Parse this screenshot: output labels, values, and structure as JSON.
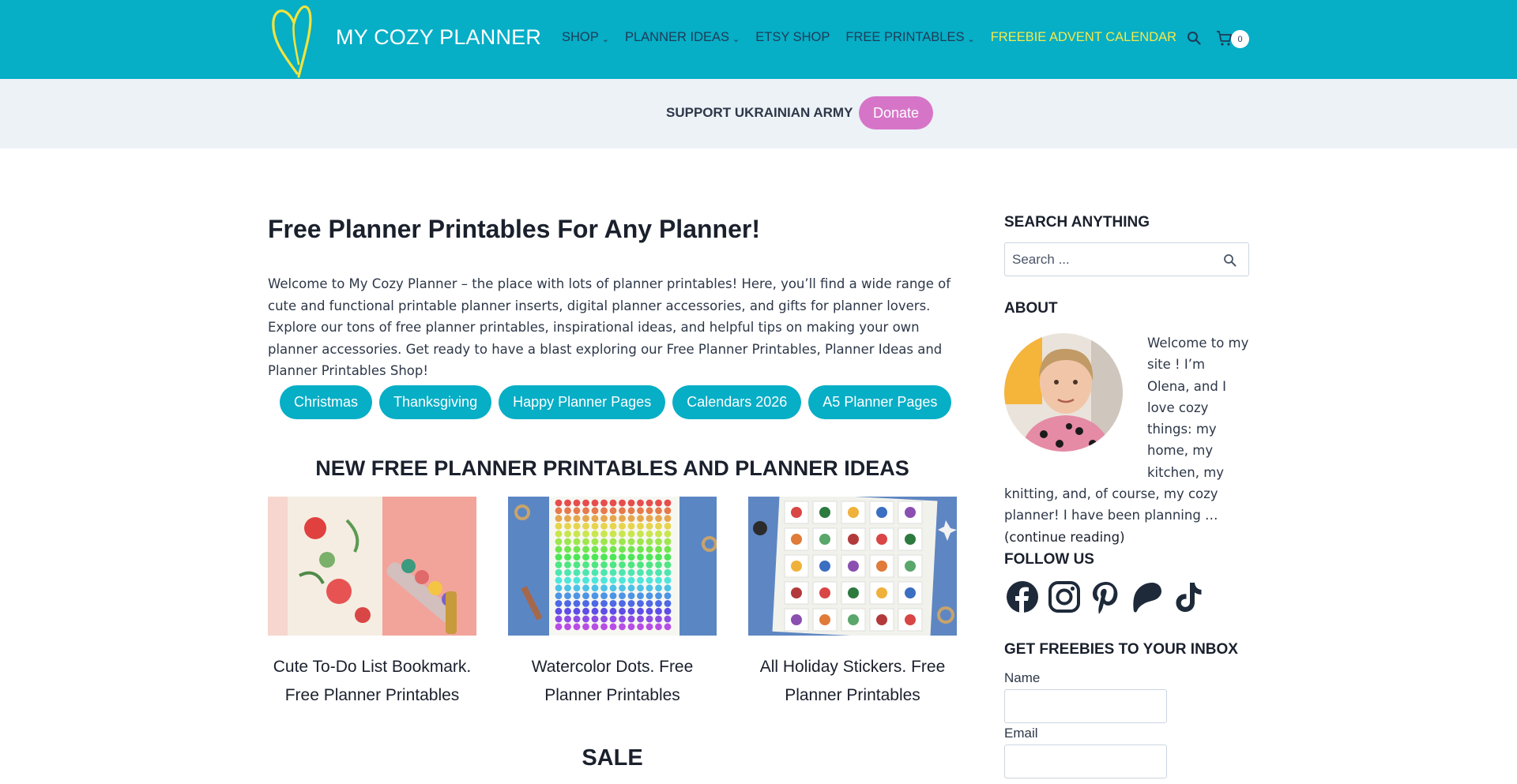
{
  "header": {
    "logo_text": "MY COZY PLANNER",
    "nav": [
      {
        "label": "SHOP",
        "dropdown": true
      },
      {
        "label": "PLANNER IDEAS",
        "dropdown": true
      },
      {
        "label": "ETSY SHOP",
        "dropdown": false
      },
      {
        "label": "FREE PRINTABLES",
        "dropdown": true
      },
      {
        "label": "FREEBIE ADVENT CALENDAR",
        "dropdown": false
      }
    ],
    "chevron": "⌄",
    "cart_count": "0",
    "colors": {
      "bar": "#06aec6",
      "nav_text": "#1e3b57",
      "highlight": "#f5e94a"
    }
  },
  "support": {
    "text": "SUPPORT UKRAINIAN ARMY",
    "donate_label": "Donate",
    "donate_color": "#d675c8"
  },
  "main": {
    "title": "Free Planner Printables For Any Planner!",
    "intro": "Welcome to My Cozy Planner – the place with lots of planner printables! Here, you’ll find a wide range of cute and functional printable planner inserts, digital planner accessories, and gifts for planner lovers. Explore our tons of free planner printables, inspirational ideas, and helpful tips on making your own planner accessories. Get ready to have a blast exploring our Free Planner Printables, Planner Ideas and Planner Printables Shop!",
    "pills": [
      "Christmas",
      "Thanksgiving",
      "Happy Planner Pages",
      "Calendars 2026",
      "A5 Planner Pages"
    ],
    "section_title": "NEW FREE PLANNER PRINTABLES AND PLANNER IDEAS",
    "cards": [
      {
        "title": "Cute To-Do List Bookmark. Free Planner Printables"
      },
      {
        "title": "Watercolor Dots. Free Planner Printables"
      },
      {
        "title": "All Holiday Stickers. Free Planner Printables"
      }
    ],
    "sale_title": "SALE"
  },
  "sidebar": {
    "search_heading": "SEARCH ANYTHING",
    "search_placeholder": "Search ...",
    "about_heading": "ABOUT",
    "about_text": "Welcome to my site ! I’m Olena, and I love cozy things: my home, my kitchen, my knitting, and, of course, my cozy planner! I have been planning …",
    "continue_label": "(continue reading)",
    "follow_heading": "FOLLOW US",
    "social": [
      "facebook-icon",
      "instagram-icon",
      "pinterest-icon",
      "patreon-icon",
      "tiktok-icon"
    ],
    "freebies_heading": "GET FREEBIES TO YOUR INBOX",
    "name_label": "Name",
    "email_label": "Email"
  }
}
